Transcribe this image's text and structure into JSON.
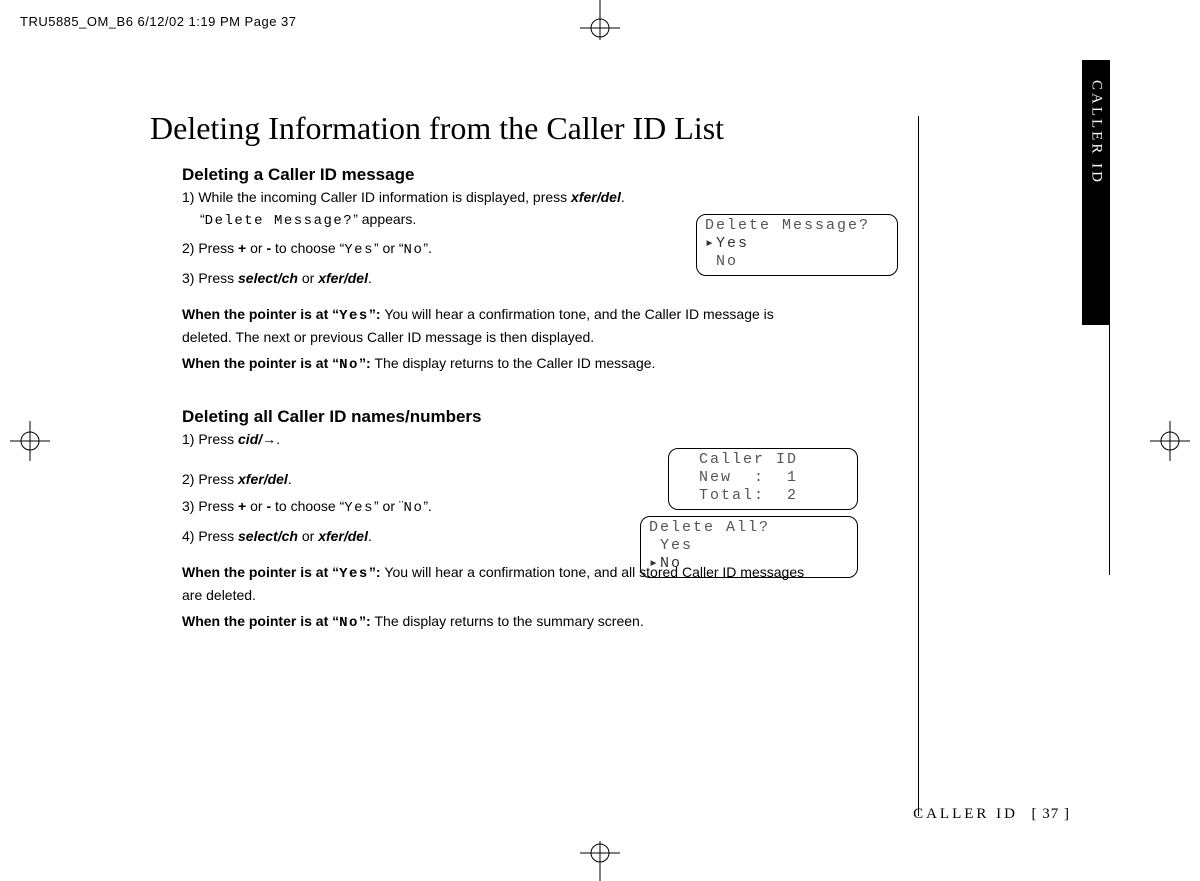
{
  "cropHeader": "TRU5885_OM_B6  6/12/02  1:19 PM  Page 37",
  "tabLabel": "CALLER ID",
  "title": "Deleting Information from the Caller ID List",
  "section1": {
    "heading": "Deleting a Caller ID message",
    "step1_pre": "1) While the incoming Caller ID information is displayed, press ",
    "step1_btn": "xfer/del",
    "step1_post": ".",
    "step1_sub_open": "“",
    "step1_sub_lcd": "Delete Message?",
    "step1_sub_close": "” appears.",
    "step2_pre": "2) Press ",
    "step2_b1": "+",
    "step2_mid1": " or ",
    "step2_b2": "-",
    "step2_mid2": " to choose “",
    "step2_lcd1": "Yes",
    "step2_mid3": "” or “",
    "step2_lcd2": "No",
    "step2_post": "”.",
    "step3_pre": "3) Press ",
    "step3_b1": "select/ch",
    "step3_mid": " or ",
    "step3_b2": "xfer/del",
    "step3_post": ".",
    "yes_pre": "When the pointer is at “",
    "yes_lcd": "Yes",
    "yes_mid": "”: ",
    "yes_body": "You will hear a confirmation tone, and the Caller ID message is deleted. The next or previous Caller ID message is then displayed.",
    "no_pre": "When the pointer is at “",
    "no_lcd": "No",
    "no_mid": "”: ",
    "no_body": "The display returns to the Caller ID message."
  },
  "section2": {
    "heading": "Deleting all Caller ID names/numbers",
    "step1_pre": "1) Press ",
    "step1_b": "cid/",
    "step1_arrow": "→",
    "step1_post": ".",
    "step2_pre": "2) Press ",
    "step2_b": "xfer/del",
    "step2_post": ".",
    "step3_pre": "3) Press ",
    "step3_b1": "+",
    "step3_mid1": " or ",
    "step3_b2": "-",
    "step3_mid2": " to choose “",
    "step3_lcd1": "Yes",
    "step3_mid3": "” or ¨",
    "step3_lcd2": "No",
    "step3_post": "”.",
    "step4_pre": "4) Press ",
    "step4_b1": "select/ch",
    "step4_mid": " or ",
    "step4_b2": "xfer/del",
    "step4_post": ".",
    "yes_pre": "When the pointer is at “",
    "yes_lcd": "Yes",
    "yes_mid": "”: ",
    "yes_body": "You will hear a confirmation tone, and all stored Caller ID messages are deleted.",
    "no_pre": "When the pointer is at “",
    "no_lcd": "No",
    "no_mid": "”: ",
    "no_body": "The display returns to the summary screen."
  },
  "lcd1": {
    "l1": "Delete Message?",
    "l2": "▸Yes",
    "l3": " No"
  },
  "lcd2": {
    "l1": "  Caller ID",
    "l2": "  New  :  1",
    "l3": "  Total:  2"
  },
  "lcd3": {
    "l1": "Delete All?",
    "l2": " Yes",
    "l3": "▸No"
  },
  "footer": {
    "section": "CALLER ID",
    "page": "[ 37 ]"
  }
}
